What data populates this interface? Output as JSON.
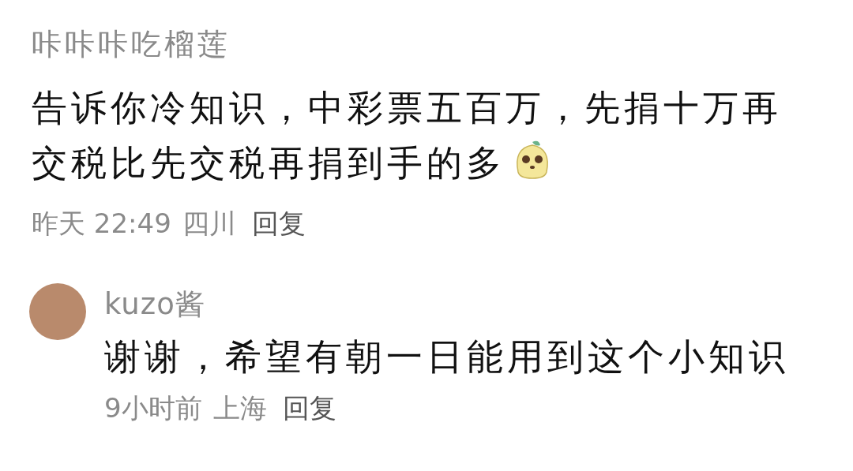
{
  "comments": [
    {
      "author": "咔咔咔吃榴莲",
      "text": "告诉你冷知识，中彩票五百万，先捐十万再交税比先交税再捐到手的多",
      "emoji": true,
      "time": "昨天 22:49",
      "location": "四川",
      "reply_label": "回复",
      "replies": [
        {
          "author": "kuzo酱",
          "text": "谢谢，希望有朝一日能用到这个小知识",
          "emoji": false,
          "time": "9小时前",
          "location": "上海",
          "reply_label": "回复"
        }
      ]
    }
  ]
}
